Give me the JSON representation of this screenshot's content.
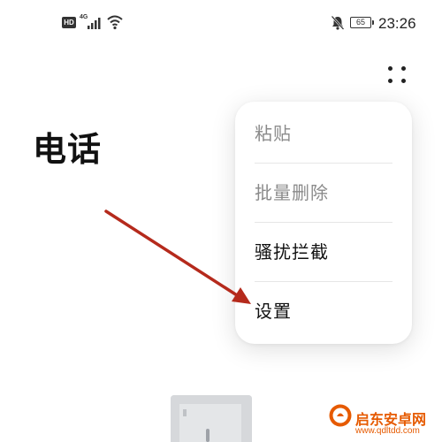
{
  "status_bar": {
    "hd_label": "HD",
    "network_label": "4G",
    "battery_level": "65",
    "time": "23:26",
    "icons": [
      "hd-icon",
      "signal-icon",
      "wifi-icon",
      "bell-muted-icon",
      "battery-icon"
    ]
  },
  "header": {
    "more_icon": "more-dots-icon"
  },
  "page": {
    "title": "电话"
  },
  "menu": {
    "items": [
      {
        "label": "粘贴",
        "state": "disabled"
      },
      {
        "label": "批量删除",
        "state": "disabled"
      },
      {
        "label": "骚扰拦截",
        "state": "enabled"
      },
      {
        "label": "设置",
        "state": "enabled"
      }
    ]
  },
  "annotation": {
    "arrow_color": "#b52a1c",
    "target": "设置"
  },
  "watermark": {
    "name": "启东安卓网",
    "url": "www.qdltdd.com",
    "brand_color": "#e65a00"
  }
}
